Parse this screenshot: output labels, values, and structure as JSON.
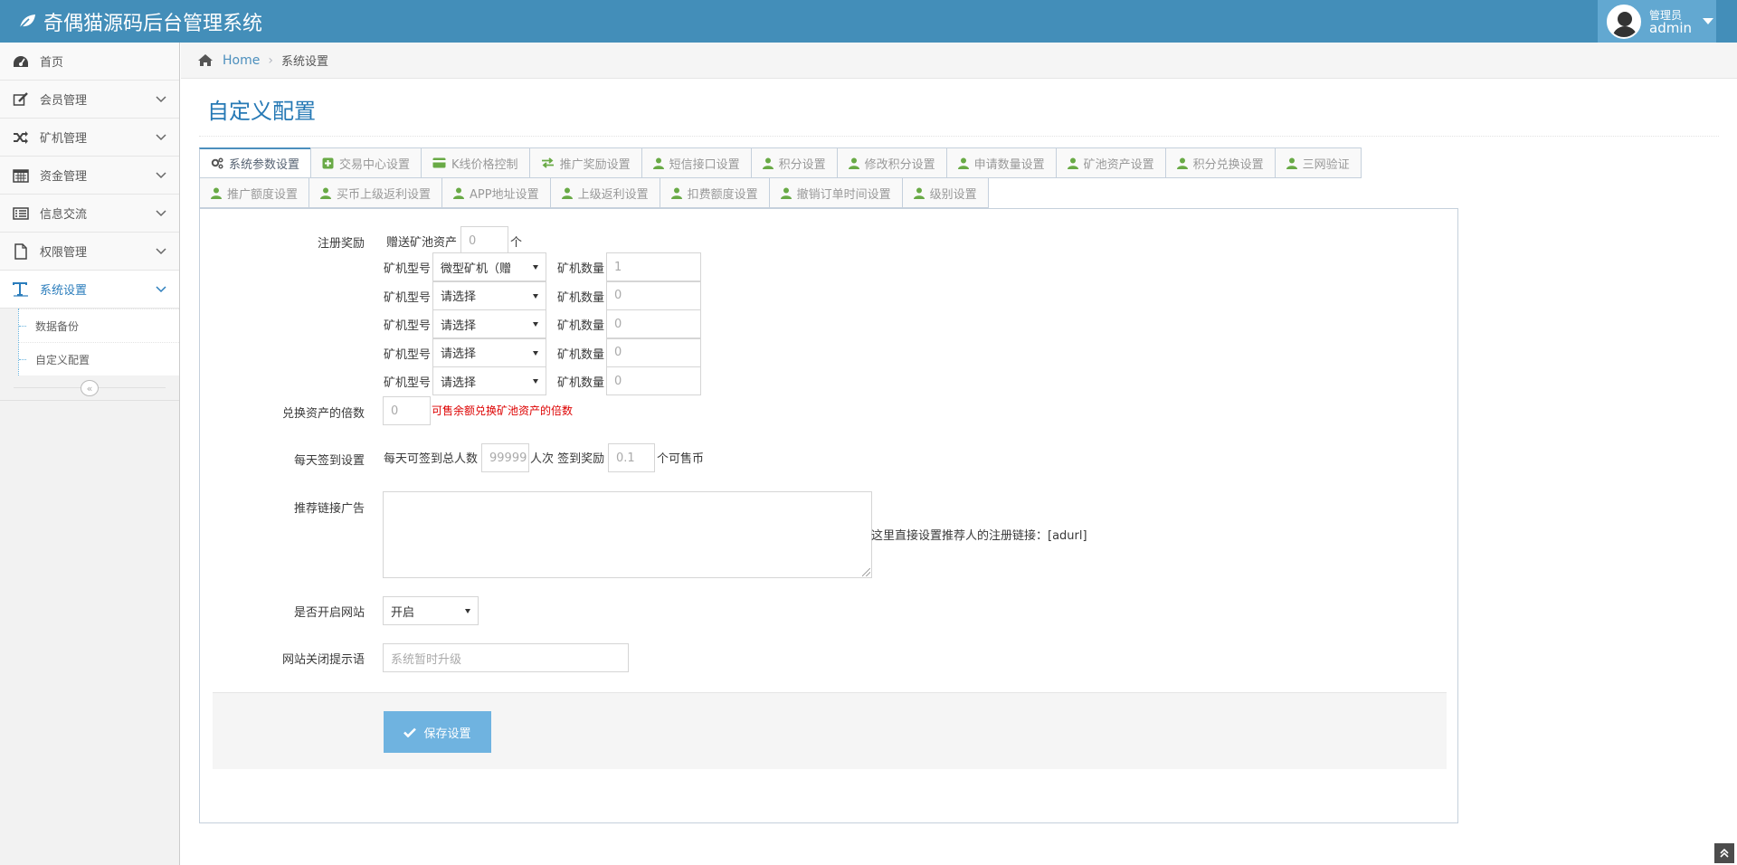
{
  "app": {
    "title": "奇偶猫源码后台管理系统"
  },
  "user": {
    "role": "管理员",
    "name": "admin"
  },
  "sidebar": {
    "items": [
      {
        "label": "首页",
        "icon": "dashboard-icon"
      },
      {
        "label": "会员管理",
        "icon": "edit-icon"
      },
      {
        "label": "矿机管理",
        "icon": "random-icon"
      },
      {
        "label": "资金管理",
        "icon": "calendar-icon"
      },
      {
        "label": "信息交流",
        "icon": "list-icon"
      },
      {
        "label": "权限管理",
        "icon": "file-icon"
      },
      {
        "label": "系统设置",
        "icon": "text-icon"
      }
    ],
    "subitems": [
      {
        "label": "数据备份"
      },
      {
        "label": "自定义配置"
      }
    ]
  },
  "breadcrumb": {
    "home": "Home",
    "current": "系统设置"
  },
  "page": {
    "title": "自定义配置"
  },
  "tabs": {
    "row1": [
      {
        "label": "系统参数设置",
        "icon": "cogs-icon"
      },
      {
        "label": "交易中心设置",
        "icon": "plus-square-icon"
      },
      {
        "label": "K线价格控制",
        "icon": "credit-card-icon"
      },
      {
        "label": "推广奖励设置",
        "icon": "exchange-icon"
      },
      {
        "label": "短信接口设置",
        "icon": "user-icon"
      },
      {
        "label": "积分设置",
        "icon": "user-icon"
      },
      {
        "label": "修改积分设置",
        "icon": "user-icon"
      },
      {
        "label": "申请数量设置",
        "icon": "user-icon"
      },
      {
        "label": "矿池资产设置",
        "icon": "user-icon"
      },
      {
        "label": "积分兑换设置",
        "icon": "user-icon"
      },
      {
        "label": "三网验证",
        "icon": "user-icon"
      }
    ],
    "row2": [
      {
        "label": "推广额度设置",
        "icon": "user-icon"
      },
      {
        "label": "买币上级返利设置",
        "icon": "user-icon"
      },
      {
        "label": "APP地址设置",
        "icon": "user-icon"
      },
      {
        "label": "上级返利设置",
        "icon": "user-icon"
      },
      {
        "label": "扣费额度设置",
        "icon": "user-icon"
      },
      {
        "label": "撤销订单时间设置",
        "icon": "user-icon"
      },
      {
        "label": "级别设置",
        "icon": "user-icon"
      }
    ]
  },
  "form": {
    "register_reward": {
      "label": "注册奖励",
      "gift_label": "赠送矿池资产",
      "gift_value": "0",
      "gift_unit": "个",
      "machine_label": "矿机型号",
      "count_label": "矿机数量",
      "rows": [
        {
          "model": "微型矿机（赠",
          "count": "1"
        },
        {
          "model": "请选择",
          "count": "0"
        },
        {
          "model": "请选择",
          "count": "0"
        },
        {
          "model": "请选择",
          "count": "0"
        },
        {
          "model": "请选择",
          "count": "0"
        }
      ]
    },
    "exchange_multiple": {
      "label": "兑换资产的倍数",
      "value": "0",
      "hint": "可售余额兑换矿池资产的倍数"
    },
    "daily_checkin": {
      "label": "每天签到设置",
      "prefix": "每天可签到总人数",
      "total_value": "99999",
      "mid": "人次 签到奖励",
      "reward_value": "0.1",
      "suffix": "个可售币"
    },
    "referral_ad": {
      "label": "推荐链接广告",
      "value": "",
      "hint": "这里直接设置推荐人的注册链接：[adurl]"
    },
    "site_open": {
      "label": "是否开启网站",
      "value": "开启"
    },
    "close_message": {
      "label": "网站关闭提示语",
      "placeholder": "系统暂时升级"
    },
    "save_label": "保存设置"
  },
  "colors": {
    "header": "#438eb9",
    "user_box": "#62a8d1",
    "accent": "#2679b5",
    "save_button": "#6fb3e0",
    "hint_red": "#dd0000"
  }
}
